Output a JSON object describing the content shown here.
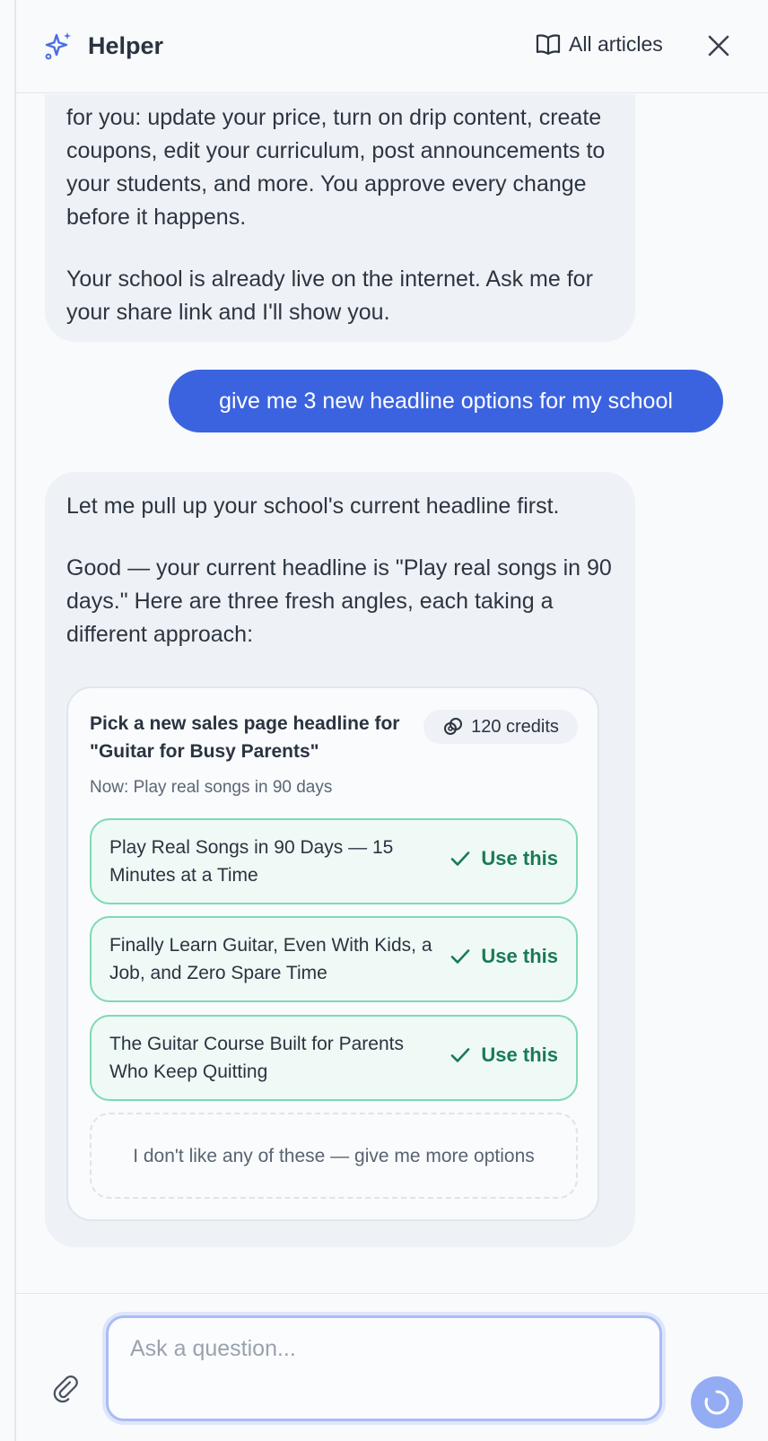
{
  "header": {
    "title": "Helper",
    "articles_label": "All articles"
  },
  "messages": {
    "bot_1": [
      "for you: update your price, turn on drip content, create coupons, edit your curriculum, post announcements to your students, and more. You approve every change before it happens.",
      "Your school is already live on the internet. Ask me for your share link and I'll show you."
    ],
    "user_1": "give me 3 new headline options for my school",
    "bot_2": [
      "Let me pull up your school's current headline first.",
      "Good — your current headline is \"Play real songs in 90 days.\" Here are three fresh angles, each taking a different approach:"
    ]
  },
  "card": {
    "title": "Pick a new sales page headline for \"Guitar for Busy Parents\"",
    "credits": "120 credits",
    "current": "Now: Play real songs in 90 days",
    "options": [
      {
        "text": "Play Real Songs in 90 Days — 15 Minutes at a Time",
        "action": "Use this"
      },
      {
        "text": "Finally Learn Guitar, Even With Kids, a Job, and Zero Spare Time",
        "action": "Use this"
      },
      {
        "text": "The Guitar Course Built for Parents Who Keep Quitting",
        "action": "Use this"
      }
    ],
    "more_label": "I don't like any of these — give me more options"
  },
  "composer": {
    "placeholder": "Ask a question..."
  },
  "colors": {
    "accent": "#3b63e0",
    "option_border": "#7fd9b5",
    "option_text": "#1a7a55"
  },
  "icons": {
    "brand": "sparkles-icon",
    "articles": "book-open-icon",
    "close": "close-icon",
    "credits": "coins-icon",
    "check": "check-icon",
    "attach": "paperclip-icon",
    "send": "loading-spinner-icon"
  }
}
